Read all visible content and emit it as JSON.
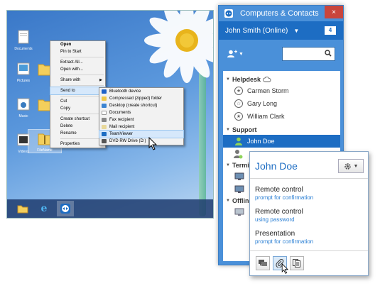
{
  "desktop": {
    "icons": [
      {
        "label": "Documents"
      },
      {
        "label": "Pictures"
      },
      {
        "label": "Music"
      },
      {
        "label": "Videos"
      },
      {
        "label": "FileName"
      }
    ],
    "context_menu": {
      "items": [
        {
          "label": "Open",
          "bold": true
        },
        {
          "label": "Pin to Start"
        },
        {
          "label": "Extract All..."
        },
        {
          "label": "Open with..."
        },
        {
          "label": "Share with",
          "submenu": true
        },
        {
          "label": "Send to",
          "submenu": true,
          "highlight": true
        },
        {
          "label": "Cut"
        },
        {
          "label": "Copy"
        },
        {
          "label": "Create shortcut"
        },
        {
          "label": "Delete"
        },
        {
          "label": "Rename"
        },
        {
          "label": "Properties"
        }
      ]
    },
    "sendto_menu": {
      "items": [
        {
          "label": "Bluetooth device"
        },
        {
          "label": "Compressed (zipped) folder"
        },
        {
          "label": "Desktop (create shortcut)"
        },
        {
          "label": "Documents"
        },
        {
          "label": "Fax recipient"
        },
        {
          "label": "Mail recipient"
        },
        {
          "label": "TeamViewer",
          "highlight": true
        },
        {
          "label": "DVD RW Drive (D:)"
        }
      ]
    }
  },
  "contacts_window": {
    "title": "Computers & Contacts",
    "close": "×",
    "user": "John Smith (Online)",
    "badge": "4",
    "groups": [
      {
        "name": "Helpdesk",
        "contacts": [
          "Carmen Storm",
          "Gary Long",
          "William Clark"
        ]
      },
      {
        "name": "Support",
        "contacts": [
          "John Doe"
        ]
      },
      {
        "name": "Termi"
      },
      {
        "name": "Offline"
      }
    ]
  },
  "popup": {
    "name": "John Doe",
    "actions": [
      {
        "title": "Remote control",
        "sub": "prompt for confirmation"
      },
      {
        "title": "Remote control",
        "sub": "using password"
      },
      {
        "title": "Presentation",
        "sub": "prompt for confirmation"
      }
    ]
  }
}
